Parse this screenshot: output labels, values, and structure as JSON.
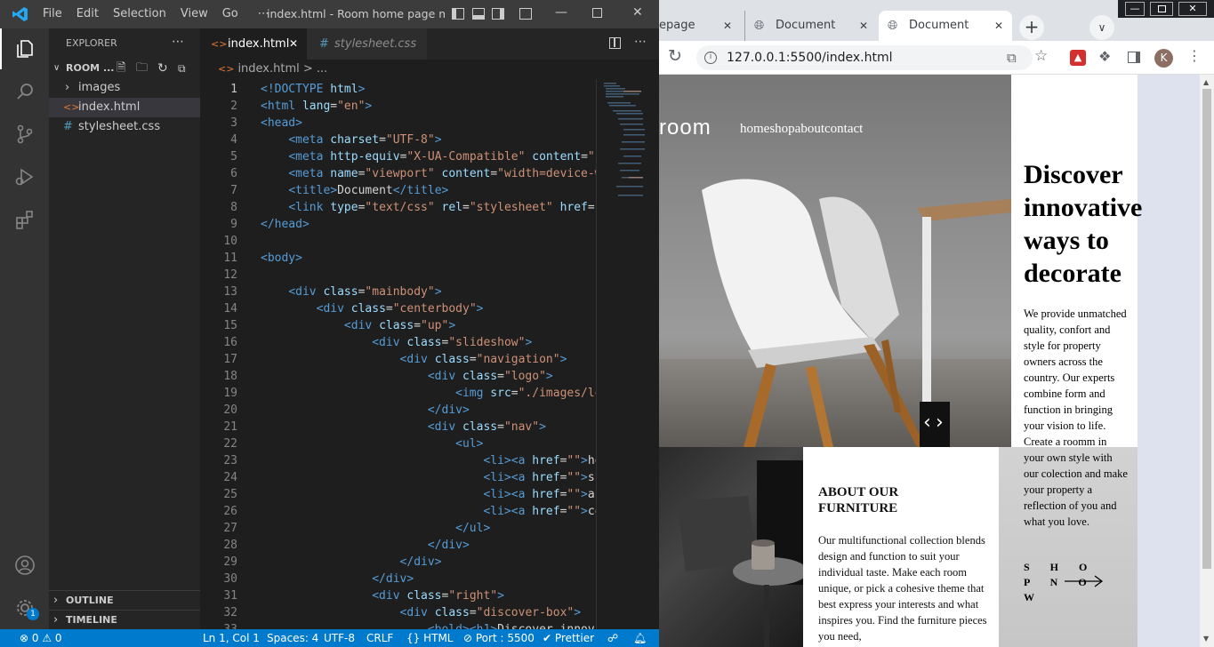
{
  "vscode": {
    "menu": [
      "File",
      "Edit",
      "Selection",
      "View",
      "Go",
      "⋯"
    ],
    "window_title": "index.html - Room home page mast...",
    "explorer": {
      "header": "EXPLORER",
      "more": "⋯",
      "project": "ROOM ...",
      "items": [
        "images",
        "index.html",
        "stylesheet.css"
      ],
      "outline": "OUTLINE",
      "timeline": "TIMELINE"
    },
    "tabs": [
      {
        "label": "index.html",
        "close": "✕"
      },
      {
        "label": "stylesheet.css"
      }
    ],
    "breadcrumb": "index.html > ...",
    "code_lines": [
      [
        [
          "t",
          "<!DOCTYPE "
        ],
        [
          "a",
          "html"
        ],
        [
          "t",
          ">"
        ]
      ],
      [
        [
          "t",
          "<html "
        ],
        [
          "a",
          "lang"
        ],
        [
          "x",
          "="
        ],
        [
          "s",
          "\"en\""
        ],
        [
          "t",
          ">"
        ]
      ],
      [
        [
          "t",
          "<head>"
        ]
      ],
      [
        [
          "x",
          "    "
        ],
        [
          "t",
          "<meta "
        ],
        [
          "a",
          "charset"
        ],
        [
          "x",
          "="
        ],
        [
          "s",
          "\"UTF-8\""
        ],
        [
          "t",
          ">"
        ]
      ],
      [
        [
          "x",
          "    "
        ],
        [
          "t",
          "<meta "
        ],
        [
          "a",
          "http-equiv"
        ],
        [
          "x",
          "="
        ],
        [
          "s",
          "\"X-UA-Compatible\" "
        ],
        [
          "a",
          "content"
        ],
        [
          "x",
          "="
        ],
        [
          "s",
          "\"I"
        ]
      ],
      [
        [
          "x",
          "    "
        ],
        [
          "t",
          "<meta "
        ],
        [
          "a",
          "name"
        ],
        [
          "x",
          "="
        ],
        [
          "s",
          "\"viewport\" "
        ],
        [
          "a",
          "content"
        ],
        [
          "x",
          "="
        ],
        [
          "s",
          "\"width=device-w"
        ]
      ],
      [
        [
          "x",
          "    "
        ],
        [
          "t",
          "<title>"
        ],
        [
          "x",
          "Document"
        ],
        [
          "t",
          "</title>"
        ]
      ],
      [
        [
          "x",
          "    "
        ],
        [
          "t",
          "<link "
        ],
        [
          "a",
          "type"
        ],
        [
          "x",
          "="
        ],
        [
          "s",
          "\"text/css\" "
        ],
        [
          "a",
          "rel"
        ],
        [
          "x",
          "="
        ],
        [
          "s",
          "\"stylesheet\" "
        ],
        [
          "a",
          "href"
        ],
        [
          "x",
          "=\""
        ]
      ],
      [
        [
          "t",
          "</head>"
        ]
      ],
      [],
      [
        [
          "t",
          "<body>"
        ]
      ],
      [],
      [
        [
          "x",
          "    "
        ],
        [
          "t",
          "<div "
        ],
        [
          "a",
          "class"
        ],
        [
          "x",
          "="
        ],
        [
          "s",
          "\"mainbody\""
        ],
        [
          "t",
          ">"
        ]
      ],
      [
        [
          "x",
          "        "
        ],
        [
          "t",
          "<div "
        ],
        [
          "a",
          "class"
        ],
        [
          "x",
          "="
        ],
        [
          "s",
          "\"centerbody\""
        ],
        [
          "t",
          ">"
        ]
      ],
      [
        [
          "x",
          "            "
        ],
        [
          "t",
          "<div "
        ],
        [
          "a",
          "class"
        ],
        [
          "x",
          "="
        ],
        [
          "s",
          "\"up\""
        ],
        [
          "t",
          ">"
        ]
      ],
      [
        [
          "x",
          "                "
        ],
        [
          "t",
          "<div "
        ],
        [
          "a",
          "class"
        ],
        [
          "x",
          "="
        ],
        [
          "s",
          "\"slideshow\""
        ],
        [
          "t",
          ">"
        ]
      ],
      [
        [
          "x",
          "                    "
        ],
        [
          "t",
          "<div "
        ],
        [
          "a",
          "class"
        ],
        [
          "x",
          "="
        ],
        [
          "s",
          "\"navigation\""
        ],
        [
          "t",
          ">"
        ]
      ],
      [
        [
          "x",
          "                        "
        ],
        [
          "t",
          "<div "
        ],
        [
          "a",
          "class"
        ],
        [
          "x",
          "="
        ],
        [
          "s",
          "\"logo\""
        ],
        [
          "t",
          ">"
        ]
      ],
      [
        [
          "x",
          "                            "
        ],
        [
          "t",
          "<img "
        ],
        [
          "a",
          "src"
        ],
        [
          "x",
          "="
        ],
        [
          "s",
          "\"./images/lo"
        ]
      ],
      [
        [
          "x",
          "                        "
        ],
        [
          "t",
          "</div>"
        ]
      ],
      [
        [
          "x",
          "                        "
        ],
        [
          "t",
          "<div "
        ],
        [
          "a",
          "class"
        ],
        [
          "x",
          "="
        ],
        [
          "s",
          "\"nav\""
        ],
        [
          "t",
          ">"
        ]
      ],
      [
        [
          "x",
          "                            "
        ],
        [
          "t",
          "<ul>"
        ]
      ],
      [
        [
          "x",
          "                                "
        ],
        [
          "t",
          "<li><a "
        ],
        [
          "a",
          "href"
        ],
        [
          "x",
          "="
        ],
        [
          "s",
          "\"\""
        ],
        [
          "t",
          ">"
        ],
        [
          "x",
          "ho"
        ]
      ],
      [
        [
          "x",
          "                                "
        ],
        [
          "t",
          "<li><a "
        ],
        [
          "a",
          "href"
        ],
        [
          "x",
          "="
        ],
        [
          "s",
          "\"\""
        ],
        [
          "t",
          ">"
        ],
        [
          "x",
          "sh"
        ]
      ],
      [
        [
          "x",
          "                                "
        ],
        [
          "t",
          "<li><a "
        ],
        [
          "a",
          "href"
        ],
        [
          "x",
          "="
        ],
        [
          "s",
          "\"\""
        ],
        [
          "t",
          ">"
        ],
        [
          "x",
          "ab"
        ]
      ],
      [
        [
          "x",
          "                                "
        ],
        [
          "t",
          "<li><a "
        ],
        [
          "a",
          "href"
        ],
        [
          "x",
          "="
        ],
        [
          "s",
          "\"\""
        ],
        [
          "t",
          ">"
        ],
        [
          "x",
          "co"
        ]
      ],
      [
        [
          "x",
          "                            "
        ],
        [
          "t",
          "</ul>"
        ]
      ],
      [
        [
          "x",
          "                        "
        ],
        [
          "t",
          "</div>"
        ]
      ],
      [
        [
          "x",
          "                    "
        ],
        [
          "t",
          "</div>"
        ]
      ],
      [
        [
          "x",
          "                "
        ],
        [
          "t",
          "</div>"
        ]
      ],
      [
        [
          "x",
          "                "
        ],
        [
          "t",
          "<div "
        ],
        [
          "a",
          "class"
        ],
        [
          "x",
          "="
        ],
        [
          "s",
          "\"right\""
        ],
        [
          "t",
          ">"
        ]
      ],
      [
        [
          "x",
          "                    "
        ],
        [
          "t",
          "<div "
        ],
        [
          "a",
          "class"
        ],
        [
          "x",
          "="
        ],
        [
          "s",
          "\"discover-box\""
        ],
        [
          "t",
          ">"
        ]
      ],
      [
        [
          "x",
          "                        "
        ],
        [
          "t",
          "<bold><h1>"
        ],
        [
          "x",
          "Discover innova"
        ]
      ]
    ],
    "status": {
      "errors": "⊗ 0 ⚠ 0",
      "position": "Ln 1, Col 1",
      "spaces": "Spaces: 4",
      "encoding": "UTF-8",
      "eol": "CRLF",
      "language": "{} HTML",
      "port": "⊘ Port : 5500",
      "prettier": "✔ Prettier",
      "badge": "1"
    }
  },
  "chrome": {
    "tabs": [
      {
        "label": "epage",
        "close": "✕"
      },
      {
        "label": "Document",
        "close": "✕"
      },
      {
        "label": "Document",
        "close": "✕",
        "active": true
      }
    ],
    "new_tab": "+",
    "url": "127.0.0.1:5500/index.html",
    "profile_initial": "K",
    "page": {
      "logo": "room",
      "nav": [
        "home",
        "shop",
        "about",
        "contact"
      ],
      "headline": "Discover innovative ways to decorate",
      "description": "We provide unmatched quality, confort and style for property owners across the country. Our experts combine form and function in bringing your vision to life. Create a roomm in your own style with our colection and make your property a reflection of you and what you love.",
      "shop_now": "S H O P N O W",
      "about_title": "ABOUT OUR FURNITURE",
      "about_text": "Our multifunctional collection blends design and function to suit your individual taste. Make each room unique, or pick a cohesive theme that best express your interests and what inspires you. Find the furniture pieces you need,"
    }
  }
}
